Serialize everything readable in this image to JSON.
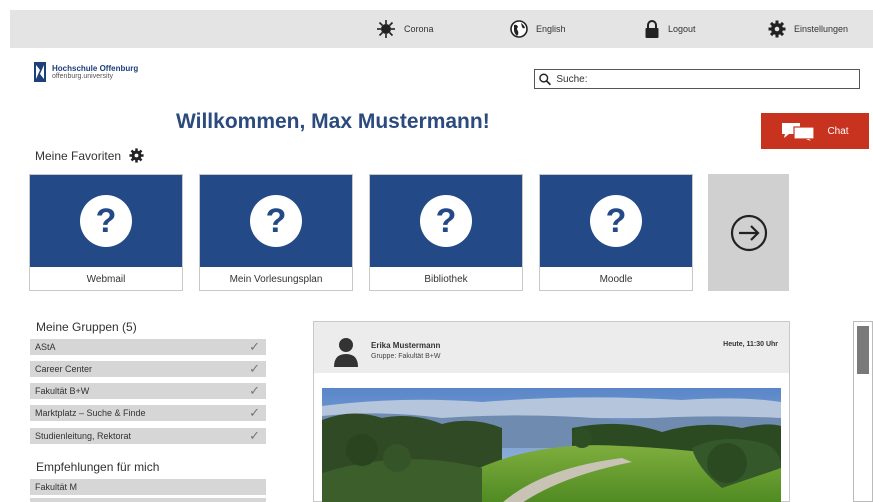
{
  "topbar": {
    "items": [
      {
        "label": "Corona",
        "icon": "virus-icon"
      },
      {
        "label": "English",
        "icon": "globe-icon"
      },
      {
        "label": "Logout",
        "icon": "lock-icon"
      },
      {
        "label": "Einstellungen",
        "icon": "gear-icon"
      }
    ]
  },
  "logo": {
    "name": "Hochschule Offenburg",
    "subtitle": "offenburg.university"
  },
  "search": {
    "label": "Suche:",
    "value": ""
  },
  "welcome": "Willkommen, Max Mustermann!",
  "chat": {
    "label": "Chat"
  },
  "favorites": {
    "title": "Meine Favoriten",
    "tiles": [
      {
        "label": "Webmail",
        "glyph": "?"
      },
      {
        "label": "Mein Vorlesungsplan",
        "glyph": "?"
      },
      {
        "label": "Bibliothek",
        "glyph": "?"
      },
      {
        "label": "Moodle",
        "glyph": "?"
      }
    ]
  },
  "groups": {
    "title": "Meine Gruppen (5)",
    "items": [
      {
        "label": "AStA"
      },
      {
        "label": "Career Center"
      },
      {
        "label": "Fakultät B+W"
      },
      {
        "label": "Marktplatz – Suche & Finde"
      },
      {
        "label": "Studienleitung, Rektorat"
      }
    ]
  },
  "recommendations": {
    "title": "Empfehlungen für mich",
    "items": [
      {
        "label": "Fakultät M"
      }
    ]
  },
  "post": {
    "author": "Erika Mustermann",
    "group": "Gruppe: Fakultät B+W",
    "time": "Heute, 11:30 Uhr"
  },
  "colors": {
    "brand_blue": "#234a86",
    "chat_red": "#c8331f",
    "topbar_gray": "#e4e4e4"
  }
}
